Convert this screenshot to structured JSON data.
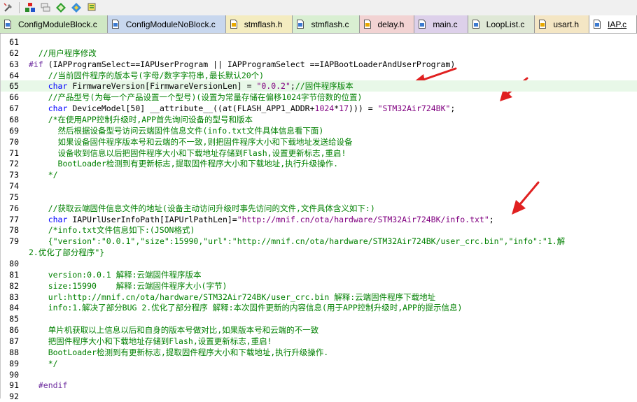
{
  "tabs": [
    {
      "label": "ConfigModuleBlock.c",
      "color": "#cfe8c4",
      "icon": "c-file-icon"
    },
    {
      "label": "ConfigModuleNoBlock.c",
      "color": "#c8d7ee",
      "icon": "c-file-icon"
    },
    {
      "label": "stmflash.h",
      "color": "#f4ecc0",
      "icon": "h-file-icon"
    },
    {
      "label": "stmflash.c",
      "color": "#d9efd2",
      "icon": "c-file-icon"
    },
    {
      "label": "delay.h",
      "color": "#f2d3d3",
      "icon": "h-file-icon"
    },
    {
      "label": "main.c",
      "color": "#ddd0ea",
      "icon": "c-file-icon"
    },
    {
      "label": "LoopList.c",
      "color": "#dfe8d6",
      "icon": "c-file-icon"
    },
    {
      "label": "usart.h",
      "color": "#f4e6c4",
      "icon": "h-file-icon"
    },
    {
      "label": "IAP.c",
      "color": "#ffffff",
      "icon": "c-file-icon"
    }
  ],
  "toolbar": [
    "build-icon",
    "stack-icon",
    "diamond-icon",
    "target-icon",
    "flag-icon"
  ],
  "lines": [
    {
      "n": "61",
      "segs": []
    },
    {
      "n": "62",
      "segs": [
        {
          "t": "  ",
          "c": ""
        },
        {
          "t": "//用户程序修改",
          "c": "cm"
        }
      ]
    },
    {
      "n": "63",
      "segs": [
        {
          "t": "#if ",
          "c": "pp"
        },
        {
          "t": "(IAPProgramSelect==IAPUserProgram || IAPProgramSelect ==IAPBootLoaderAndUserProgram)",
          "c": ""
        }
      ]
    },
    {
      "n": "64",
      "segs": [
        {
          "t": "    ",
          "c": ""
        },
        {
          "t": "//当前固件程序的版本号(字母/数字字符串,最长默认20个)",
          "c": "cm"
        }
      ]
    },
    {
      "n": "65",
      "hl": true,
      "segs": [
        {
          "t": "    ",
          "c": ""
        },
        {
          "t": "char",
          "c": "kw"
        },
        {
          "t": " FirmwareVersion[FirmwareVersionLen] = ",
          "c": ""
        },
        {
          "t": "\"0.0.2\"",
          "c": "str"
        },
        {
          "t": ";",
          "c": ""
        },
        {
          "t": "//固件程序版本",
          "c": "cm"
        }
      ]
    },
    {
      "n": "66",
      "segs": [
        {
          "t": "    ",
          "c": ""
        },
        {
          "t": "//产品型号(为每一个产品设置一个型号)(设置为常量存储在偏移1024字节倍数的位置)",
          "c": "cm"
        }
      ]
    },
    {
      "n": "67",
      "segs": [
        {
          "t": "    ",
          "c": ""
        },
        {
          "t": "char",
          "c": "kw"
        },
        {
          "t": " DeviceModel[50] __attribute__((at(FLASH_APP1_ADDR+",
          "c": ""
        },
        {
          "t": "1024",
          "c": "str"
        },
        {
          "t": "*",
          "c": ""
        },
        {
          "t": "17",
          "c": "str"
        },
        {
          "t": "))) = ",
          "c": ""
        },
        {
          "t": "\"STM32Air724BK\"",
          "c": "str"
        },
        {
          "t": ";",
          "c": ""
        }
      ]
    },
    {
      "n": "68",
      "segs": [
        {
          "t": "    ",
          "c": ""
        },
        {
          "t": "/*在使用APP控制升级时,APP首先询问设备的型号和版本",
          "c": "cm"
        }
      ]
    },
    {
      "n": "69",
      "segs": [
        {
          "t": "      ",
          "c": ""
        },
        {
          "t": "然后根据设备型号访问云端固件信息文件(info.txt文件具体信息看下面)",
          "c": "cm"
        }
      ]
    },
    {
      "n": "70",
      "segs": [
        {
          "t": "      ",
          "c": ""
        },
        {
          "t": "如果设备固件程序版本号和云端的不一致,则把固件程序大小和下载地址发送给设备",
          "c": "cm"
        }
      ]
    },
    {
      "n": "71",
      "segs": [
        {
          "t": "      ",
          "c": ""
        },
        {
          "t": "设备收到信息以后把固件程序大小和下载地址存储到Flash,设置更新标志,重启!",
          "c": "cm"
        }
      ]
    },
    {
      "n": "72",
      "segs": [
        {
          "t": "      ",
          "c": ""
        },
        {
          "t": "BootLoader检测到有更新标志,提取固件程序大小和下载地址,执行升级操作.",
          "c": "cm"
        }
      ]
    },
    {
      "n": "73",
      "segs": [
        {
          "t": "    ",
          "c": ""
        },
        {
          "t": "*/",
          "c": "cm"
        }
      ]
    },
    {
      "n": "74",
      "segs": []
    },
    {
      "n": "75",
      "segs": []
    },
    {
      "n": "76",
      "segs": [
        {
          "t": "    ",
          "c": ""
        },
        {
          "t": "//获取云端固件信息文件的地址(设备主动访问升级时事先访问的文件,文件具体含义如下:)",
          "c": "cm"
        }
      ]
    },
    {
      "n": "77",
      "segs": [
        {
          "t": "    ",
          "c": ""
        },
        {
          "t": "char",
          "c": "kw"
        },
        {
          "t": " IAPUrlUserInfoPath[IAPUrlPathLen]=",
          "c": ""
        },
        {
          "t": "\"http://mnif.cn/ota/hardware/STM32Air724BK/info.txt\"",
          "c": "str"
        },
        {
          "t": ";",
          "c": ""
        }
      ]
    },
    {
      "n": "78",
      "segs": [
        {
          "t": "    ",
          "c": ""
        },
        {
          "t": "/*info.txt文件信息如下:(JSON格式)",
          "c": "cm"
        }
      ]
    },
    {
      "n": "79",
      "segs": [
        {
          "t": "    ",
          "c": ""
        },
        {
          "t": "{\"version\":\"0.0.1\",\"size\":15990,\"url\":\"http://mnif.cn/ota/hardware/STM32Air724BK/user_crc.bin\",\"info\":\"1.解",
          "c": "cm"
        }
      ]
    },
    {
      "n": "",
      "segs": [
        {
          "t": "2.优化了部分程序\"}",
          "c": "cm"
        }
      ]
    },
    {
      "n": "80",
      "segs": []
    },
    {
      "n": "81",
      "segs": [
        {
          "t": "    ",
          "c": ""
        },
        {
          "t": "version:0.0.1 解释:云端固件程序版本",
          "c": "cm"
        }
      ]
    },
    {
      "n": "82",
      "segs": [
        {
          "t": "    ",
          "c": ""
        },
        {
          "t": "size:15990    解释:云端固件程序大小(字节)",
          "c": "cm"
        }
      ]
    },
    {
      "n": "83",
      "segs": [
        {
          "t": "    ",
          "c": ""
        },
        {
          "t": "url:http://mnif.cn/ota/hardware/STM32Air724BK/user_crc.bin 解释:云端固件程序下载地址",
          "c": "cm"
        }
      ]
    },
    {
      "n": "84",
      "segs": [
        {
          "t": "    ",
          "c": ""
        },
        {
          "t": "info:1.解决了部分BUG 2.优化了部分程序 解释:本次固件更新的内容信息(用于APP控制升级时,APP的提示信息)",
          "c": "cm"
        }
      ]
    },
    {
      "n": "85",
      "segs": []
    },
    {
      "n": "86",
      "segs": [
        {
          "t": "    ",
          "c": ""
        },
        {
          "t": "单片机获取以上信息以后和自身的版本号做对比,如果版本号和云端的不一致",
          "c": "cm"
        }
      ]
    },
    {
      "n": "87",
      "segs": [
        {
          "t": "    ",
          "c": ""
        },
        {
          "t": "把固件程序大小和下载地址存储到Flash,设置更新标志,重启!",
          "c": "cm"
        }
      ]
    },
    {
      "n": "88",
      "segs": [
        {
          "t": "    ",
          "c": ""
        },
        {
          "t": "BootLoader检测到有更新标志,提取固件程序大小和下载地址,执行升级操作.",
          "c": "cm"
        }
      ]
    },
    {
      "n": "89",
      "segs": [
        {
          "t": "    ",
          "c": ""
        },
        {
          "t": "*/",
          "c": "cm"
        }
      ]
    },
    {
      "n": "90",
      "segs": []
    },
    {
      "n": "91",
      "segs": [
        {
          "t": "  ",
          "c": ""
        },
        {
          "t": "#endif",
          "c": "pp"
        }
      ]
    },
    {
      "n": "92",
      "segs": []
    }
  ]
}
